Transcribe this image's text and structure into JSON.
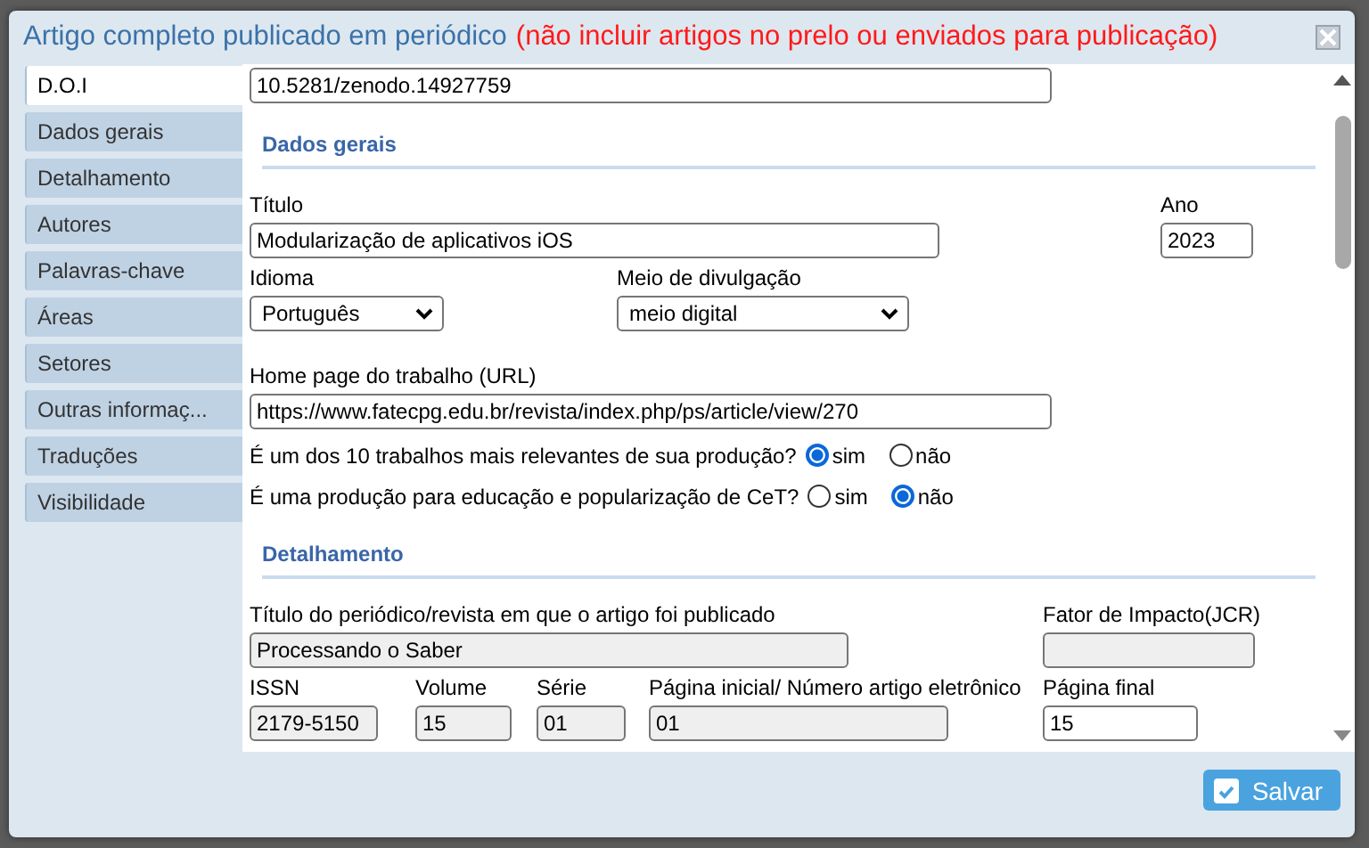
{
  "dialog": {
    "title": "Artigo completo publicado em periódico",
    "title_note": "(não incluir artigos no prelo ou enviados para publicação)"
  },
  "sidebar": {
    "items": [
      {
        "label": "D.O.I",
        "selected": true
      },
      {
        "label": "Dados gerais",
        "selected": false
      },
      {
        "label": "Detalhamento",
        "selected": false
      },
      {
        "label": "Autores",
        "selected": false
      },
      {
        "label": "Palavras-chave",
        "selected": false
      },
      {
        "label": "Áreas",
        "selected": false
      },
      {
        "label": "Setores",
        "selected": false
      },
      {
        "label": "Outras informaç...",
        "selected": false
      },
      {
        "label": "Traduções",
        "selected": false
      },
      {
        "label": "Visibilidade",
        "selected": false
      }
    ]
  },
  "doi_field": {
    "value": "10.5281/zenodo.14927759"
  },
  "sections": [
    {
      "heading": "Dados gerais",
      "rows": [
        {
          "kind": "fields",
          "fields": [
            {
              "label": "Título",
              "kind": "text",
              "value": "Modularização de aplicativos iOS",
              "disabled": false
            },
            {
              "label": "Ano",
              "kind": "text",
              "value": "2023",
              "disabled": false
            }
          ]
        },
        {
          "kind": "fields",
          "fields": [
            {
              "label": "Idioma",
              "kind": "select",
              "value": "Português",
              "disabled": false
            },
            {
              "label": "Meio de divulgação",
              "kind": "select",
              "value": "meio digital",
              "disabled": false
            }
          ]
        },
        {
          "kind": "fields",
          "fields": [
            {
              "label": "Home page do trabalho (URL)",
              "kind": "text",
              "value": "https://www.fatecpg.edu.br/revista/index.php/ps/article/view/270",
              "disabled": false
            }
          ]
        },
        {
          "kind": "radio",
          "question": "É um dos 10 trabalhos mais relevantes de sua produção?",
          "options": [
            {
              "label": "sim",
              "selected": true
            },
            {
              "label": "não",
              "selected": false
            }
          ]
        },
        {
          "kind": "radio",
          "question": "É uma produção para educação e popularização de CeT?",
          "options": [
            {
              "label": "sim",
              "selected": false
            },
            {
              "label": "não",
              "selected": true
            }
          ]
        }
      ]
    },
    {
      "heading": "Detalhamento",
      "rows": [
        {
          "kind": "fields",
          "fields": [
            {
              "label": "Título do periódico/revista em que o artigo foi publicado",
              "kind": "text",
              "value": "Processando o Saber",
              "disabled": true
            },
            {
              "label": "Fator de Impacto(JCR)",
              "kind": "text",
              "disabled": true
            }
          ]
        },
        {
          "kind": "fields",
          "fields": [
            {
              "label": "ISSN",
              "kind": "text",
              "value": "2179-5150",
              "disabled": true
            },
            {
              "label": "Volume",
              "kind": "text",
              "value": "15",
              "disabled": true
            },
            {
              "label": "Série",
              "kind": "text",
              "value": "01",
              "disabled": true
            },
            {
              "label": "Página inicial/ Número artigo eletrônico",
              "kind": "text",
              "value": "01",
              "disabled": true
            },
            {
              "label": "Página final",
              "kind": "text",
              "value": "15",
              "disabled": false
            }
          ]
        }
      ]
    }
  ],
  "footer": {
    "save_button": "Salvar"
  }
}
